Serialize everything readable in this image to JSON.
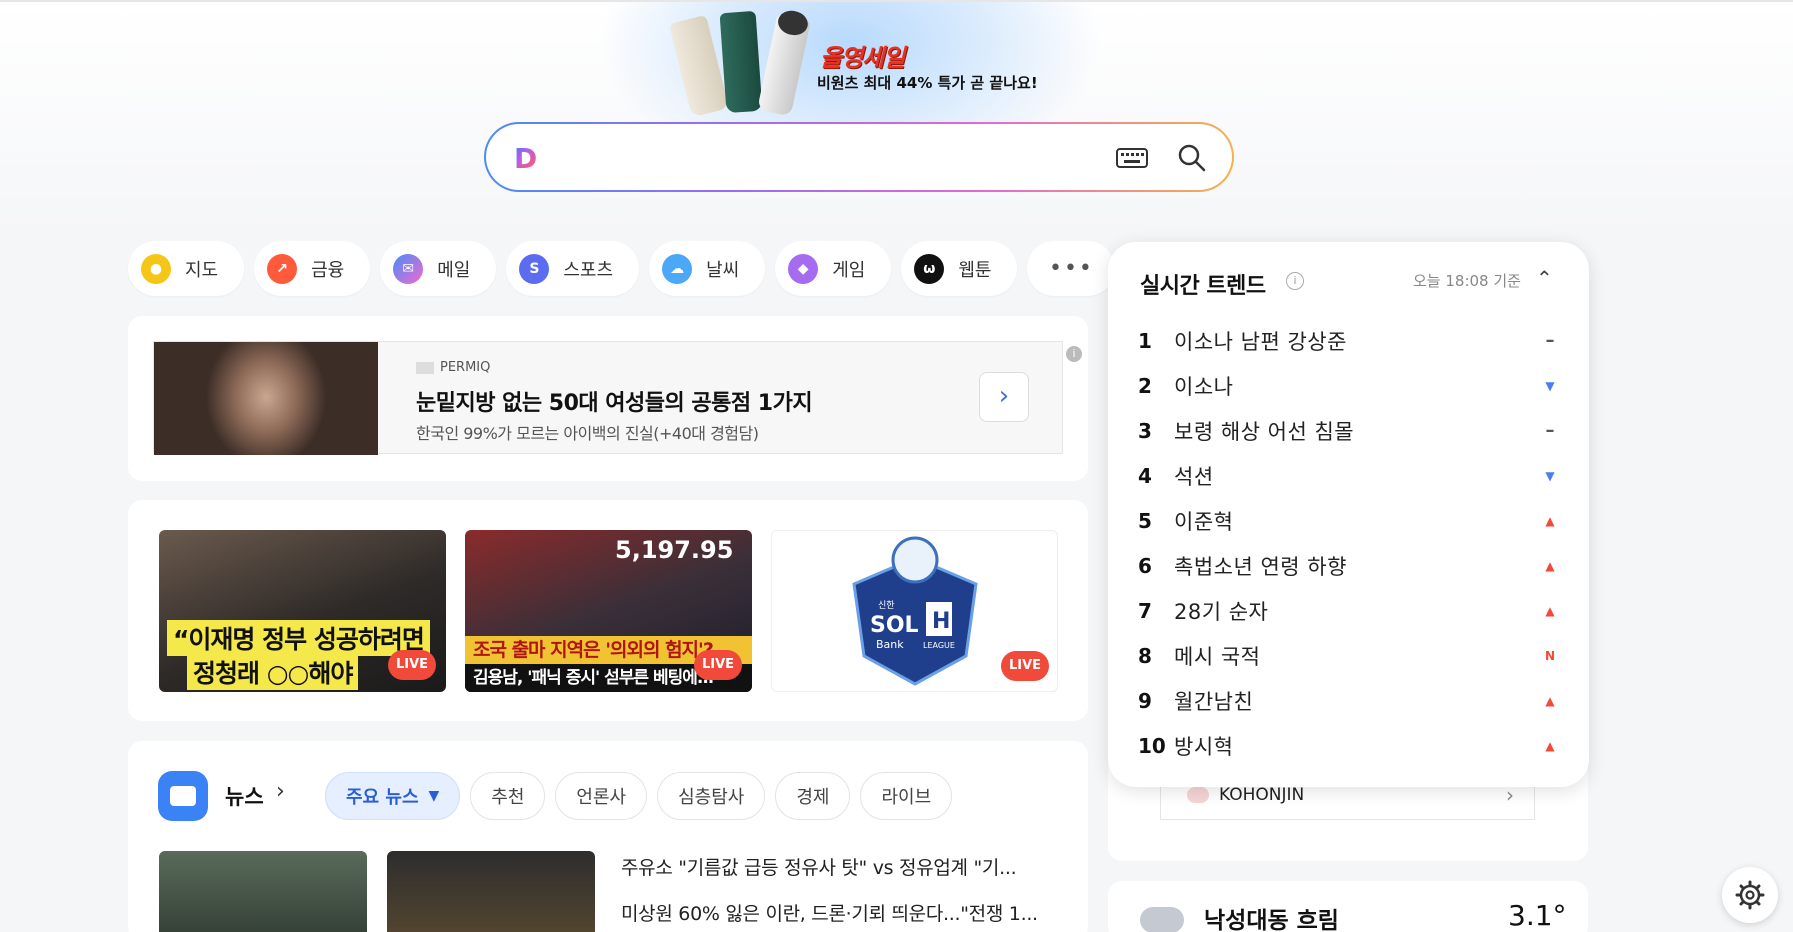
{
  "banner": {
    "sale_title": "올영세일",
    "sale_sub": "비원츠 최대 44% 특가 곧 끝나요!"
  },
  "search": {
    "logo": "D",
    "value": "",
    "placeholder": ""
  },
  "shortcuts": [
    {
      "label": "지도",
      "icon": "map-pin-icon",
      "color": "#f5c518"
    },
    {
      "label": "금융",
      "icon": "finance-chart-icon",
      "color": "#ff5a3c"
    },
    {
      "label": "메일",
      "icon": "mail-icon",
      "color": "#4a8cf7"
    },
    {
      "label": "스포츠",
      "icon": "sports-icon",
      "color": "#5b6cf0"
    },
    {
      "label": "날씨",
      "icon": "weather-icon",
      "color": "#4aa8f7"
    },
    {
      "label": "게임",
      "icon": "game-controller-icon",
      "color": "#a66cf0"
    },
    {
      "label": "웹툰",
      "icon": "webtoon-icon",
      "color": "#111111"
    }
  ],
  "ad": {
    "brand": "PERMIQ",
    "title": "눈밑지방 없는 50대 여성들의 공통점 1가지",
    "subtitle": "한국인 99%가 모르는 아이백의 진실(+40대 경험담)",
    "info": "i"
  },
  "videos": {
    "v1_line1": "“이재명 정부 성공하려면",
    "v1_line2": "정청래 ○○해야",
    "v2_number": "5,197.95",
    "v2_line1": "조국 출마 지역은 '의외의 험지'?",
    "v2_line2": "김용남, '패닉 증시' 섣부른 베팅에...",
    "live_label": "LIVE",
    "v3_logo_top": "신한",
    "v3_logo_sol": "SOL",
    "v3_logo_bank": "Bank",
    "v3_logo_league": "LEAGUE"
  },
  "news": {
    "title": "뉴스",
    "tabs": [
      "주요 뉴스",
      "추천",
      "언론사",
      "심층탐사",
      "경제",
      "라이브"
    ],
    "headlines": [
      "주유소 \"기름값 급등 정유사 탓\" vs 정유업계 \"기...",
      "미상원 60% 잃은 이란, 드론·기뢰 띄운다...\"전쟁 1..."
    ]
  },
  "trend": {
    "title": "실시간 트렌드",
    "time": "오늘 18:08 기준",
    "items": [
      {
        "rank": "1",
        "keyword": "이소나 남편 강상준",
        "status": "same"
      },
      {
        "rank": "2",
        "keyword": "이소나",
        "status": "down"
      },
      {
        "rank": "3",
        "keyword": "보령 해상 어선 침몰",
        "status": "same"
      },
      {
        "rank": "4",
        "keyword": "석션",
        "status": "down"
      },
      {
        "rank": "5",
        "keyword": "이준혁",
        "status": "up"
      },
      {
        "rank": "6",
        "keyword": "촉법소년 연령 하향",
        "status": "up"
      },
      {
        "rank": "7",
        "keyword": "28기 순자",
        "status": "up"
      },
      {
        "rank": "8",
        "keyword": "메시 국적",
        "status": "new"
      },
      {
        "rank": "9",
        "keyword": "월간남친",
        "status": "up"
      },
      {
        "rank": "10",
        "keyword": "방시혁",
        "status": "up"
      }
    ],
    "status_glyphs": {
      "same": "–",
      "down": "▼",
      "up": "▲",
      "new": "N"
    }
  },
  "side": {
    "kohonjin": "KOHONJIN"
  },
  "weather": {
    "location": "낙성대동 흐림",
    "temp": "3.1°"
  }
}
